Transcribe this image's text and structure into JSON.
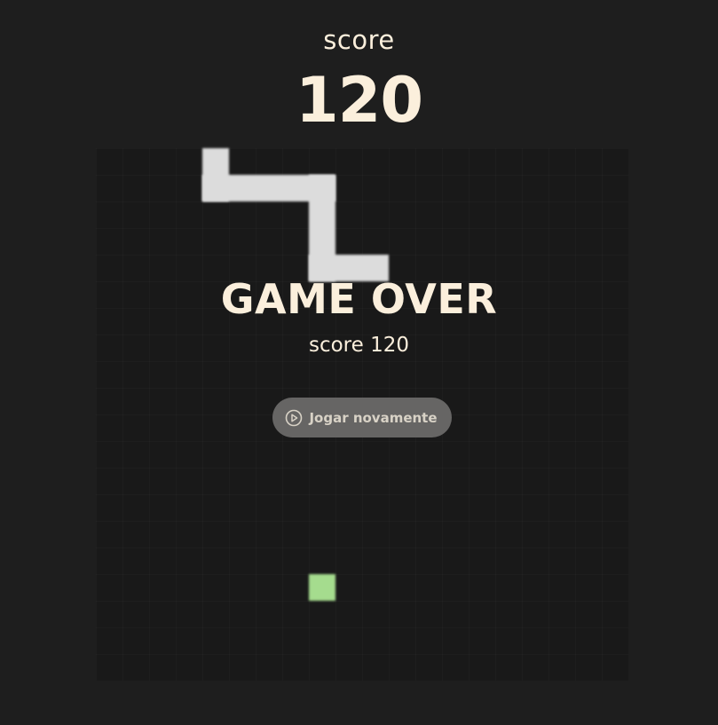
{
  "header": {
    "score_label": "score",
    "score_value": "120"
  },
  "game_over": {
    "title": "GAME OVER",
    "score_label": "score",
    "score_value": "120",
    "play_again_label": "Jogar novamente",
    "play_again_icon": "play-circle-icon"
  },
  "colors": {
    "background": "#1e1e1e",
    "board": "#191919",
    "text": "#fbefdc",
    "snake": "#dcdcdc",
    "food": "#a5dc8e",
    "button": "#666564"
  }
}
